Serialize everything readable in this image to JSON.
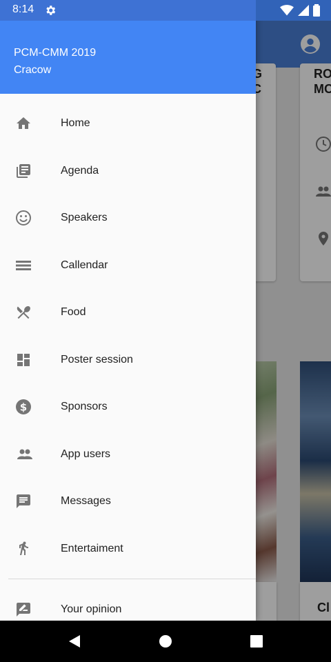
{
  "status_bar": {
    "time": "8:14"
  },
  "drawer": {
    "header": {
      "title": "PCM-CMM 2019",
      "subtitle": "Cracow"
    },
    "items": [
      {
        "label": "Home",
        "icon": "home-icon"
      },
      {
        "label": "Agenda",
        "icon": "agenda-icon"
      },
      {
        "label": "Speakers",
        "icon": "smiley-icon"
      },
      {
        "label": "Callendar",
        "icon": "calendar-lines-icon"
      },
      {
        "label": "Food",
        "icon": "food-icon"
      },
      {
        "label": "Poster session",
        "icon": "dashboard-icon"
      },
      {
        "label": "Sponsors",
        "icon": "dollar-icon"
      },
      {
        "label": "App users",
        "icon": "people-icon"
      },
      {
        "label": "Messages",
        "icon": "message-icon"
      },
      {
        "label": "Entertaiment",
        "icon": "walk-icon"
      }
    ],
    "footer_item": {
      "label": "Your opinion",
      "icon": "feedback-icon"
    }
  },
  "background": {
    "card_title_line1": "RO",
    "card_title_line2": "MO",
    "left_card_line1": "G",
    "left_card_line2": "C",
    "bottom_card_text": "Cl"
  },
  "colors": {
    "drawer_header": "#4285f4",
    "appbar": "#3e72d4",
    "icon_gray": "#757575"
  }
}
